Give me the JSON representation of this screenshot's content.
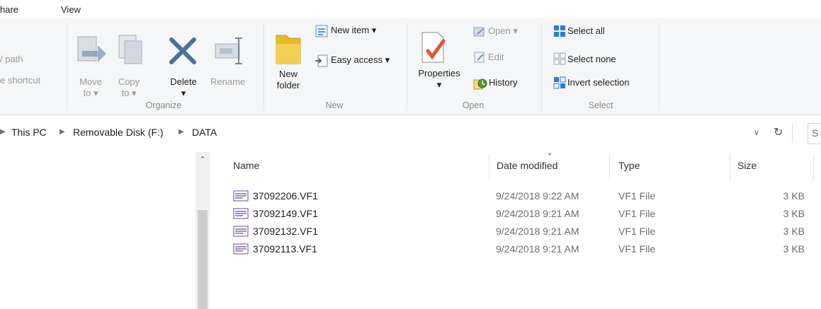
{
  "tabs": [
    "hare",
    "View"
  ],
  "ribbon": {
    "clipboard": {
      "copy_path": "/ path",
      "paste_shortcut": "e shortcut"
    },
    "organize": {
      "label": "Organize",
      "move_to": [
        "Move",
        "to ▾"
      ],
      "copy_to": [
        "Copy",
        "to ▾"
      ],
      "delete": [
        "Delete",
        "▾"
      ],
      "rename": "Rename"
    },
    "new": {
      "label": "New",
      "new_folder": [
        "New",
        "folder"
      ],
      "new_item": "New item ▾",
      "easy_access": "Easy access ▾"
    },
    "open": {
      "label": "Open",
      "properties": [
        "Properties",
        "▾"
      ],
      "open": "Open ▾",
      "edit": "Edit",
      "history": "History"
    },
    "select": {
      "label": "Select",
      "select_all": "Select all",
      "select_none": "Select none",
      "invert": "Invert selection"
    }
  },
  "address": {
    "crumbs": [
      "This PC",
      "Removable Disk (F:)",
      "DATA"
    ],
    "search_text": "S"
  },
  "columns": {
    "name": "Name",
    "date": "Date modified",
    "type": "Type",
    "size": "Size"
  },
  "files": [
    {
      "name": "37092206.VF1",
      "date": "9/24/2018 9:22 AM",
      "type": "VF1 File",
      "size": "3 KB"
    },
    {
      "name": "37092149.VF1",
      "date": "9/24/2018 9:21 AM",
      "type": "VF1 File",
      "size": "3 KB"
    },
    {
      "name": "37092132.VF1",
      "date": "9/24/2018 9:21 AM",
      "type": "VF1 File",
      "size": "3 KB"
    },
    {
      "name": "37092113.VF1",
      "date": "9/24/2018 9:21 AM",
      "type": "VF1 File",
      "size": "3 KB"
    }
  ],
  "colors": {
    "ribbon_bg": "#f5f6f7",
    "select_blue": "#2b7bd3",
    "folder_yellow": "#e8b92d"
  }
}
